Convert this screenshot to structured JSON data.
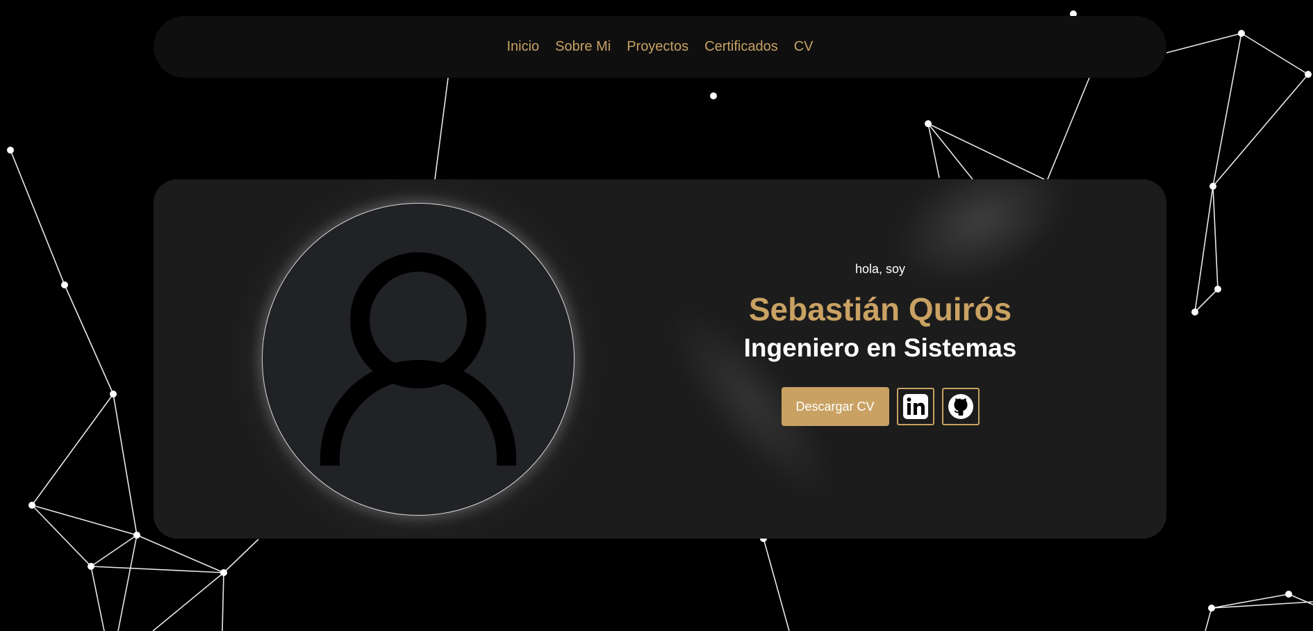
{
  "nav": {
    "items": [
      {
        "label": "Inicio"
      },
      {
        "label": "Sobre Mi"
      },
      {
        "label": "Proyectos"
      },
      {
        "label": "Certificados"
      },
      {
        "label": "CV"
      }
    ]
  },
  "hero": {
    "greeting": "hola, soy",
    "name": "Sebastián Quirós",
    "role": "Ingeniero en Sistemas",
    "download_label": "Descargar CV",
    "social": [
      {
        "icon": "linkedin-icon"
      },
      {
        "icon": "github-icon"
      }
    ],
    "avatar_icon": "user-silhouette-icon"
  },
  "colors": {
    "background": "#000000",
    "navbar": "#0f0f0f",
    "card": "#1c1c1c",
    "accent": "#c9a263",
    "text": "#ffffff",
    "avatar_fill": "#212226"
  }
}
